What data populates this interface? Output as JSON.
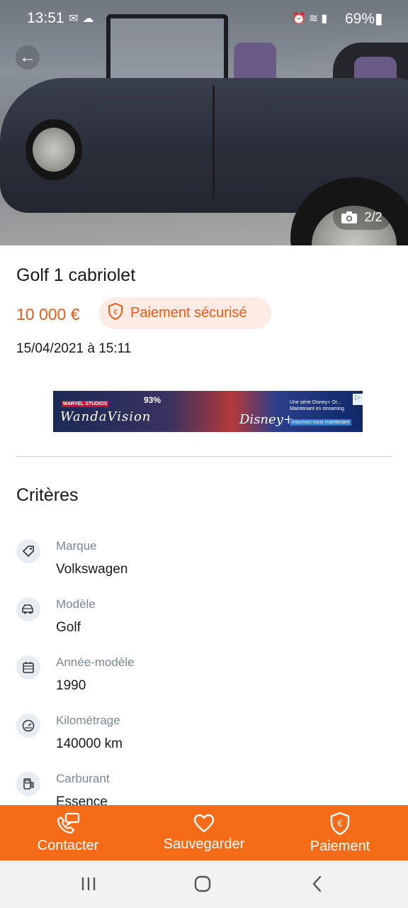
{
  "status_bar": {
    "time": "13:51",
    "battery": "69%",
    "left_icons": [
      "message-icon",
      "weather-icon"
    ],
    "right_icons": [
      "alarm-icon",
      "wifi-icon",
      "signal-icon"
    ]
  },
  "gallery": {
    "counter": "2/2",
    "icon": "camera-icon"
  },
  "listing": {
    "title": "Golf 1 cabriolet",
    "price": "10 000 €",
    "secure_payment": "Paiement sécurisé",
    "date": "15/04/2021 à 15:11"
  },
  "ad": {
    "studio": "MARVEL STUDIOS",
    "title": "WandaVision",
    "rating": "93%",
    "brand": "Disney+",
    "tagline": "Une série Disney+ Or... Maintenant en streaming",
    "cta": "Inscrivez-vous maintenant"
  },
  "criteria": {
    "section_title": "Critères",
    "items": [
      {
        "label": "Marque",
        "value": "Volkswagen",
        "icon": "tag-icon"
      },
      {
        "label": "Modèle",
        "value": "Golf",
        "icon": "car-icon"
      },
      {
        "label": "Année-modèle",
        "value": "1990",
        "icon": "calendar-icon"
      },
      {
        "label": "Kilométrage",
        "value": "140000 km",
        "icon": "speedometer-icon"
      },
      {
        "label": "Carburant",
        "value": "Essence",
        "icon": "fuel-icon"
      }
    ]
  },
  "actions": [
    {
      "label": "Contacter",
      "icon": "contact-icon"
    },
    {
      "label": "Sauvegarder",
      "icon": "heart-icon"
    },
    {
      "label": "Paiement",
      "icon": "shield-euro-icon"
    }
  ],
  "colors": {
    "accent": "#f56b17",
    "price": "#ec5a13",
    "badge_bg": "#feece4",
    "label_gray": "#7a8896"
  }
}
